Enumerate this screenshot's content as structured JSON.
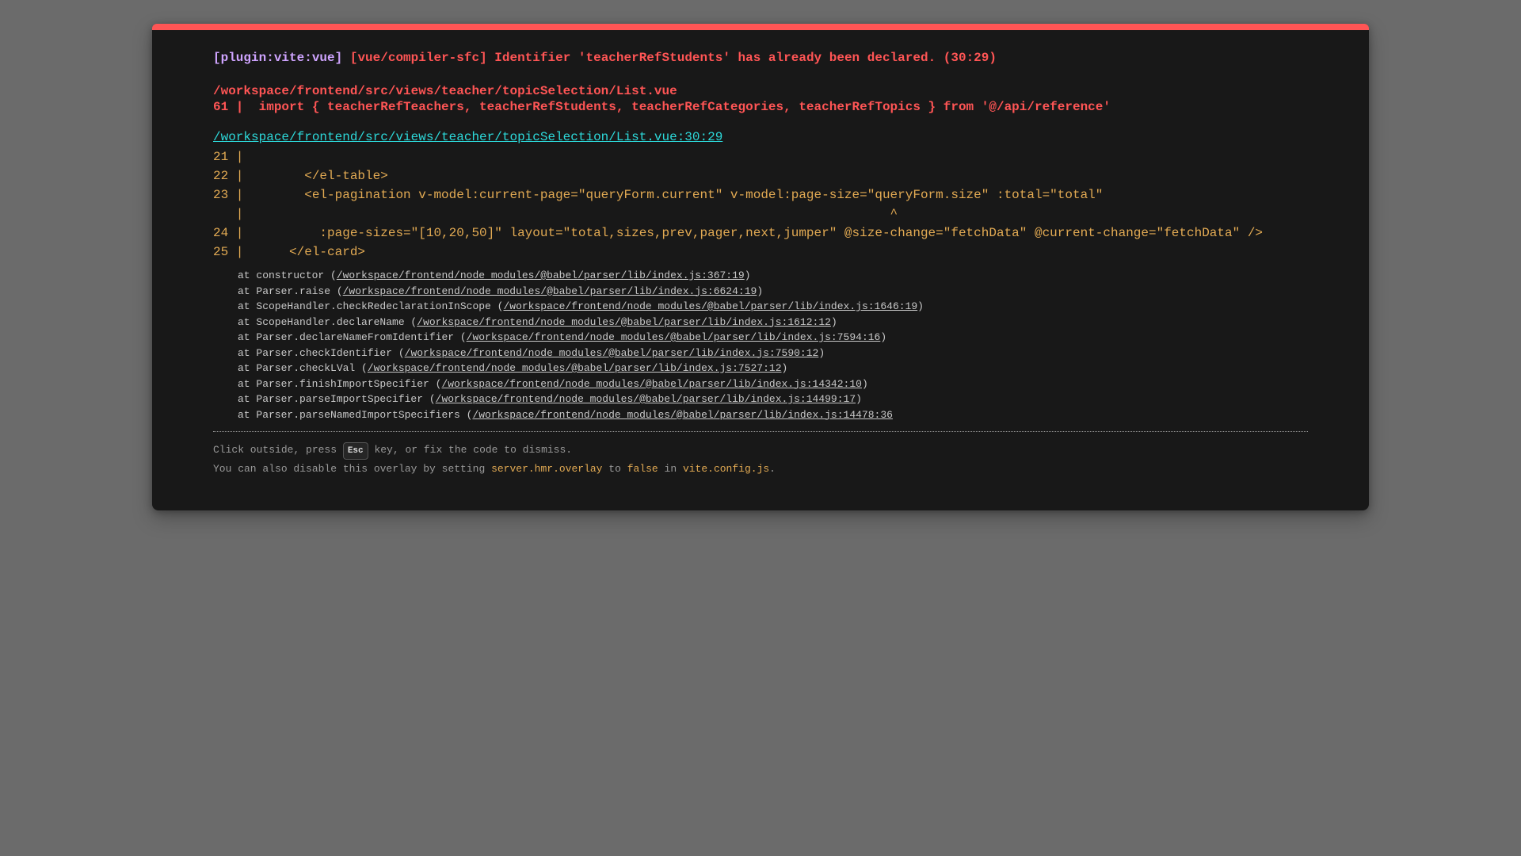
{
  "error": {
    "plugin": "[plugin:vite:vue]",
    "message": "[vue/compiler-sfc] Identifier 'teacherRefStudents' has already been declared. (30:29)",
    "file": "/workspace/frontend/src/views/teacher/topicSelection/List.vue",
    "source_line": "61 |  import { teacherRefTeachers, teacherRefStudents, teacherRefCategories, teacherRefTopics } from '@/api/reference'",
    "location_link": "/workspace/frontend/src/views/teacher/topicSelection/List.vue:30:29"
  },
  "frame_lines": [
    "21 |",
    "22 |        </el-table>",
    "23 |        <el-pagination v-model:current-page=\"queryForm.current\" v-model:page-size=\"queryForm.size\" :total=\"total\"",
    "   |                                                                                     ^",
    "24 |          :page-sizes=\"[10,20,50]\" layout=\"total,sizes,prev,pager,next,jumper\" @size-change=\"fetchData\" @current-change=\"fetchData\" />",
    "25 |      </el-card>"
  ],
  "stack": [
    {
      "prefix": "at constructor (",
      "link": "/workspace/frontend/node_modules/@babel/parser/lib/index.js:367:19",
      "suffix": ")"
    },
    {
      "prefix": "at Parser.raise (",
      "link": "/workspace/frontend/node_modules/@babel/parser/lib/index.js:6624:19",
      "suffix": ")"
    },
    {
      "prefix": "at ScopeHandler.checkRedeclarationInScope (",
      "link": "/workspace/frontend/node_modules/@babel/parser/lib/index.js:1646:19",
      "suffix": ")"
    },
    {
      "prefix": "at ScopeHandler.declareName (",
      "link": "/workspace/frontend/node_modules/@babel/parser/lib/index.js:1612:12",
      "suffix": ")"
    },
    {
      "prefix": "at Parser.declareNameFromIdentifier (",
      "link": "/workspace/frontend/node_modules/@babel/parser/lib/index.js:7594:16",
      "suffix": ")"
    },
    {
      "prefix": "at Parser.checkIdentifier (",
      "link": "/workspace/frontend/node_modules/@babel/parser/lib/index.js:7590:12",
      "suffix": ")"
    },
    {
      "prefix": "at Parser.checkLVal (",
      "link": "/workspace/frontend/node_modules/@babel/parser/lib/index.js:7527:12",
      "suffix": ")"
    },
    {
      "prefix": "at Parser.finishImportSpecifier (",
      "link": "/workspace/frontend/node_modules/@babel/parser/lib/index.js:14342:10",
      "suffix": ")"
    },
    {
      "prefix": "at Parser.parseImportSpecifier (",
      "link": "/workspace/frontend/node_modules/@babel/parser/lib/index.js:14499:17",
      "suffix": ")"
    },
    {
      "prefix": "at Parser.parseNamedImportSpecifiers (",
      "link": "/workspace/frontend/node_modules/@babel/parser/lib/index.js:14478:36",
      "suffix": ""
    }
  ],
  "tip": {
    "line1_before": "Click outside, press ",
    "key": "Esc",
    "line1_after": " key, or fix the code to dismiss.",
    "line2_a": "You can also disable this overlay by setting ",
    "line2_code1": "server.hmr.overlay",
    "line2_b": " to ",
    "line2_code2": "false",
    "line2_c": " in ",
    "line2_code3": "vite.config.js",
    "line2_d": "."
  },
  "colors": {
    "accent_red": "#ff5555",
    "plugin_purple": "#cfa4ff",
    "link_cyan": "#2dd9da",
    "code_yellow": "#e2aa53",
    "backdrop": "#6b6b6b",
    "window_bg": "#181818"
  }
}
